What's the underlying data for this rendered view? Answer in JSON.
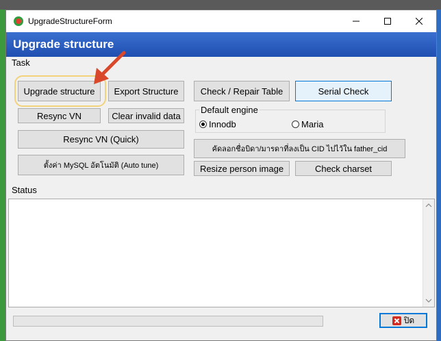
{
  "window": {
    "title": "UpgradeStructureForm",
    "header_title": "Upgrade structure"
  },
  "task": {
    "group_label": "Task",
    "buttons": {
      "upgrade_structure": "Upgrade structure",
      "export_structure": "Export Structure",
      "check_repair_table": "Check / Repair Table",
      "serial_check": "Serial Check",
      "resync_vn": "Resync VN",
      "clear_invalid_data": "Clear invalid data",
      "resync_vn_quick": "Resync VN (Quick)",
      "mysql_auto_tune": "ตั้งค่า MySQL อัตโนมัติ (Auto tune)",
      "copy_father_cid": "คัดลอกชื่อบิดา/มารดาที่ลงเป็น CID ไปไว้ใน father_cid",
      "resize_person_image": "Resize person image",
      "check_charset": "Check charset"
    },
    "default_engine": {
      "label": "Default engine",
      "options": [
        "Innodb",
        "Maria"
      ],
      "selected": "Innodb"
    }
  },
  "status": {
    "group_label": "Status",
    "text": ""
  },
  "progress": {
    "value": 0
  },
  "footer": {
    "close_label": "ปิด"
  },
  "colors": {
    "header": "#1f4fb0",
    "focus_border": "#0078d7",
    "highlight": "#f2d27a",
    "arrow": "#d9482b"
  }
}
